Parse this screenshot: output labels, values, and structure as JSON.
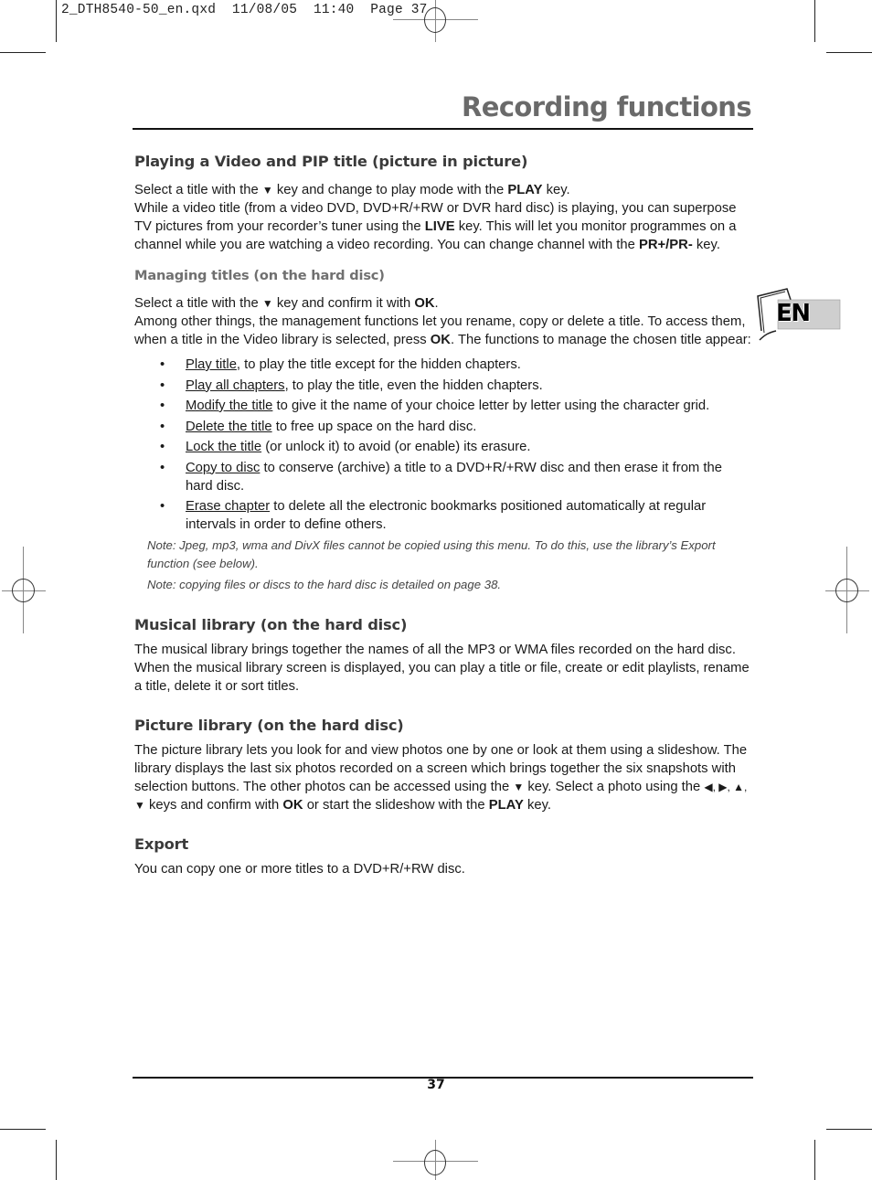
{
  "slug_line": "2_DTH8540-50_en.qxd  11/08/05  11:40  Page 37",
  "header": {
    "title": "Recording functions"
  },
  "language_tab": {
    "label": "EN"
  },
  "sections": {
    "pip": {
      "heading": "Playing a Video and PIP title (picture in picture)",
      "p1_a": "Select a title with the ",
      "p1_arrow": "▼",
      "p1_b": " key and change to play mode with the ",
      "p1_key": "PLAY",
      "p1_c": " key.",
      "p2_a": "While a video title (from a video DVD, DVD+R/+RW or DVR hard disc) is playing, you can superpose TV pictures from your recorder’s tuner using the ",
      "p2_key": "LIVE",
      "p2_b": " key. This will let you monitor programmes on a channel while you are watching a video recording. You can change channel with the ",
      "p2_key2": "PR+/PR-",
      "p2_c": " key."
    },
    "managing": {
      "heading": "Managing titles (on the hard disc)",
      "p1_a": "Select a title with the ",
      "p1_arrow": "▼",
      "p1_b": " key and confirm it with ",
      "p1_key": "OK",
      "p1_c": ".",
      "p2_a": "Among other things, the management functions let you rename, copy or delete a title. To access them, when a title in the Video library is selected, press ",
      "p2_key": "OK",
      "p2_b": ". The functions to manage the chosen title appear:",
      "bullet": "•",
      "items": [
        {
          "term": "Play title",
          "desc": ", to play the title except for the hidden chapters."
        },
        {
          "term": "Play all chapters",
          "desc": ", to play the title, even the hidden chapters."
        },
        {
          "term": "Modify the title",
          "desc": " to give it the name of your choice letter by letter using the character grid."
        },
        {
          "term": "Delete the title",
          "desc": " to free up space on the hard disc."
        },
        {
          "term": "Lock the title",
          "desc": " (or unlock it) to avoid (or enable) its erasure."
        },
        {
          "term": "Copy to disc",
          "desc": " to conserve (archive) a title to a DVD+R/+RW disc and then erase it from the hard disc."
        },
        {
          "term": "Erase chapter",
          "desc": " to delete all the electronic bookmarks positioned automatically at regular intervals in order to define others."
        }
      ],
      "note1": "Note: Jpeg, mp3, wma and DivX files cannot be copied using this menu. To do this, use the library’s Export function (see below).",
      "note2": "Note: copying files or discs to the hard disc is detailed on page 38."
    },
    "musical": {
      "heading": "Musical library (on the hard disc)",
      "p1": "The musical library brings together the names of all the MP3 or WMA files recorded on the hard disc. When the musical library screen is displayed, you can play a title or file, create or edit playlists, rename a title, delete it or sort titles."
    },
    "picture": {
      "heading": "Picture library (on the hard disc)",
      "p1_a": "The picture library lets you look for and view photos one by one or look at them using a slideshow. The library displays the last six photos recorded on a screen which brings together the six snapshots with selection buttons. The other photos can be accessed using the ",
      "arrow_down": "▼",
      "p1_b": " key. Select a photo using the ",
      "arrows_all": "◀, ▶, ▲, ▼",
      "p1_c": " keys and confirm with ",
      "p1_key": "OK",
      "p1_d": " or start the slideshow with the ",
      "p1_key2": "PLAY",
      "p1_e": " key."
    },
    "export": {
      "heading": "Export",
      "p1": "You can copy one or more titles to a DVD+R/+RW disc."
    }
  },
  "footer": {
    "page_number": "37"
  }
}
